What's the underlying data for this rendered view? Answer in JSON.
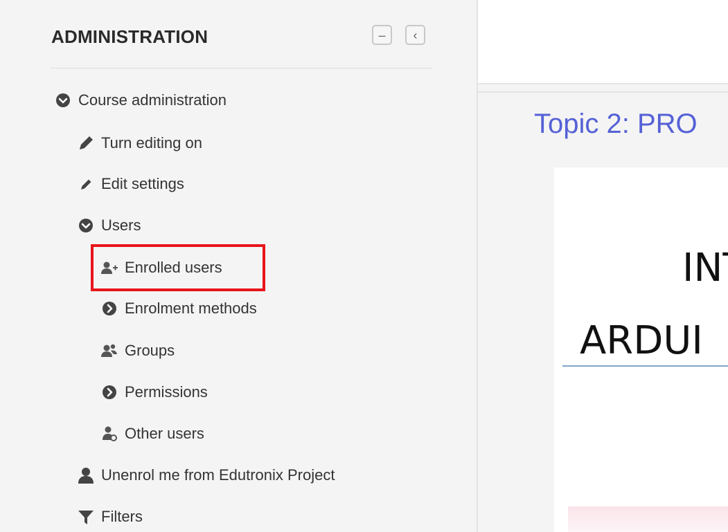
{
  "admin_block": {
    "title": "ADMINISTRATION",
    "collapse_label": "–",
    "dock_label": "‹"
  },
  "nav": {
    "course_admin": {
      "label": "Course administration",
      "icon": "chevron-down-circle-icon"
    },
    "turn_editing_on": {
      "label": "Turn editing on",
      "icon": "pencil-icon"
    },
    "edit_settings": {
      "label": "Edit settings",
      "icon": "pencil-small-icon"
    },
    "users": {
      "label": "Users",
      "icon": "chevron-down-circle-icon"
    },
    "enrolled_users": {
      "label": "Enrolled users",
      "icon": "user-plus-icon"
    },
    "enrolment_methods": {
      "label": "Enrolment methods",
      "icon": "chevron-right-circle-icon"
    },
    "groups": {
      "label": "Groups",
      "icon": "users-group-icon"
    },
    "permissions": {
      "label": "Permissions",
      "icon": "chevron-right-circle-icon"
    },
    "other_users": {
      "label": "Other users",
      "icon": "user-gear-icon"
    },
    "unenrol": {
      "label": "Unenrol me from Edutronix Project",
      "icon": "user-icon"
    },
    "filters": {
      "label": "Filters",
      "icon": "filter-icon"
    }
  },
  "main": {
    "topic_title": "Topic 2: PRO",
    "slide_line1": "INT",
    "slide_line2": "ARDUI"
  },
  "colors": {
    "highlight": "#e8141b",
    "topic_link": "#5561d6",
    "icon": "#444444"
  }
}
